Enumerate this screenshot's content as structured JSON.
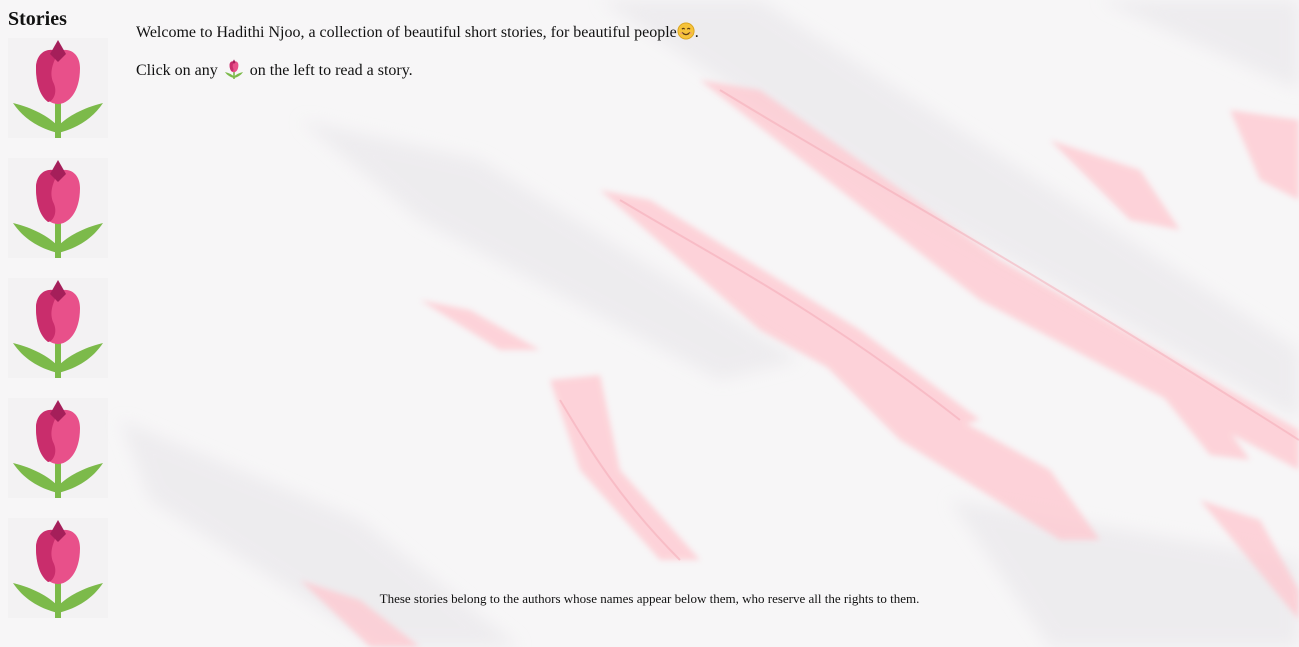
{
  "sidebar": {
    "title": "Stories",
    "items": [
      {
        "icon": "tulip-icon"
      },
      {
        "icon": "tulip-icon"
      },
      {
        "icon": "tulip-icon"
      },
      {
        "icon": "tulip-icon"
      },
      {
        "icon": "tulip-icon"
      }
    ]
  },
  "main": {
    "welcome_text": "Welcome to Hadithi Njoo, a collection of beautiful short stories, for beautiful people",
    "welcome_end": ".",
    "instruction_before": "Click on any",
    "instruction_after": "on the left to read a story."
  },
  "footer": {
    "text": "These stories belong to the authors whose names appear below them, who reserve all the rights to them."
  },
  "colors": {
    "tulip_petal": "#e8508a",
    "tulip_dark": "#c92d6c",
    "tulip_bud": "#a51f5a",
    "tulip_leaf": "#7cba4a",
    "marble_vein": "#ffc8cf",
    "smiley": "#f6c33b"
  }
}
